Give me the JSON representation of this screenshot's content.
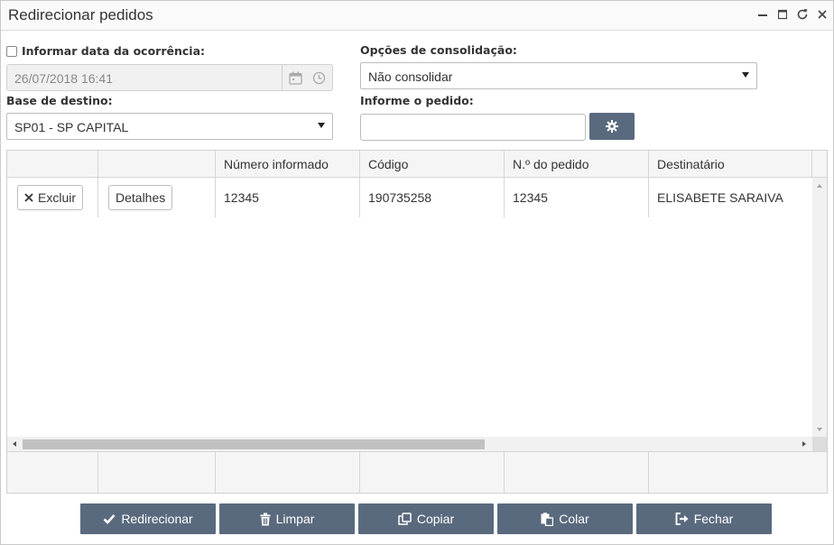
{
  "window": {
    "title": "Redirecionar pedidos"
  },
  "form": {
    "date_checkbox_label": "Informar data da ocorrência:",
    "date_value": "26/07/2018 16:41",
    "consolidation_label": "Opções de consolidação:",
    "consolidation_value": "Não consolidar",
    "destination_label": "Base de destino:",
    "destination_value": "SP01 - SP CAPITAL",
    "order_label": "Informe o pedido:",
    "order_value": ""
  },
  "grid": {
    "columns": [
      "",
      "",
      "Número informado",
      "Código",
      "N.º do pedido",
      "Destinatário"
    ],
    "rows": [
      {
        "delete_label": "Excluir",
        "details_label": "Detalhes",
        "numero_informado": "12345",
        "codigo": "190735258",
        "numero_pedido": "12345",
        "destinatario": "ELISABETE SARAIVA"
      }
    ]
  },
  "actions": {
    "redirect": "Redirecionar",
    "clear": "Limpar",
    "copy": "Copiar",
    "paste": "Colar",
    "close": "Fechar"
  },
  "colors": {
    "button_bg": "#5a6a7e",
    "button_text": "#ffffff",
    "disabled_field_bg": "#f0f0f0"
  },
  "icons": {
    "minimize": "minimize-icon",
    "maximize": "maximize-icon",
    "refresh": "refresh-icon",
    "close": "close-icon",
    "calendar": "calendar-icon",
    "clock": "clock-icon",
    "gear": "gear-icon",
    "check": "check-icon",
    "trash": "trash-icon",
    "copy": "copy-icon",
    "paste": "paste-icon",
    "exit": "exit-icon"
  }
}
